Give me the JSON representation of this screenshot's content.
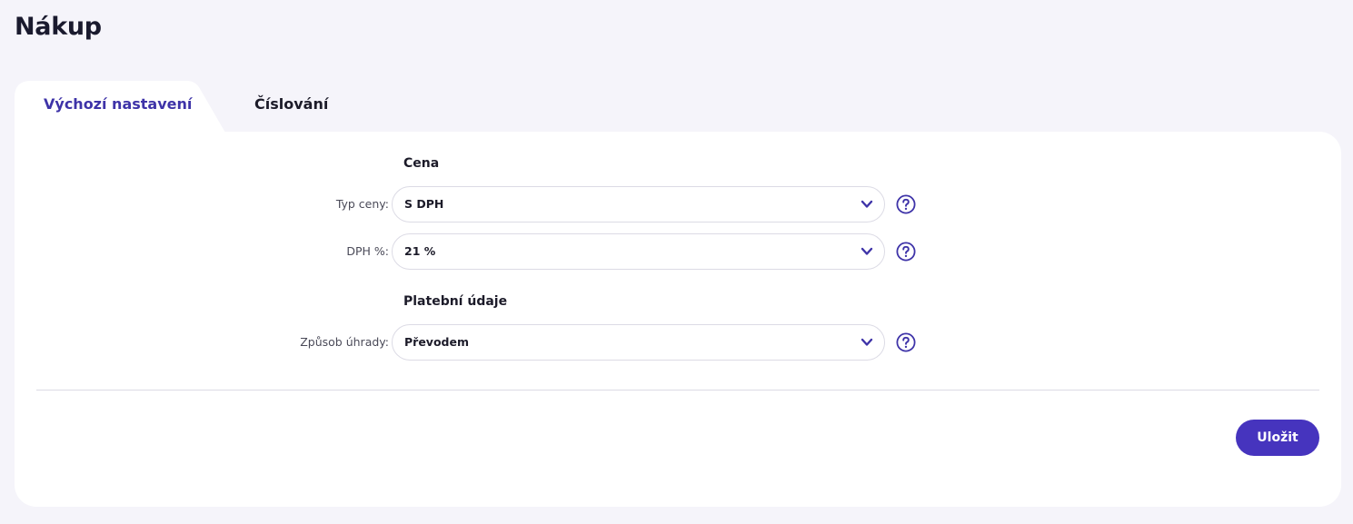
{
  "page": {
    "title": "Nákup"
  },
  "tabs": [
    {
      "label": "Výchozí nastavení",
      "active": true
    },
    {
      "label": "Číslování",
      "active": false
    }
  ],
  "sections": {
    "price": {
      "title": "Cena"
    },
    "payment": {
      "title": "Platební údaje"
    }
  },
  "fields": {
    "price_type": {
      "label": "Typ ceny:",
      "value": "S DPH"
    },
    "vat": {
      "label": "DPH %:",
      "value": "21 %"
    },
    "payment_method": {
      "label": "Způsob úhrady:",
      "value": "Převodem"
    }
  },
  "actions": {
    "save_label": "Uložit"
  },
  "icons": {
    "select": "chevron-down-icon",
    "help": "question-circle-icon"
  },
  "colors": {
    "accent": "#4634be",
    "active_tab": "#3e33a8",
    "background": "#f5f4fa"
  }
}
